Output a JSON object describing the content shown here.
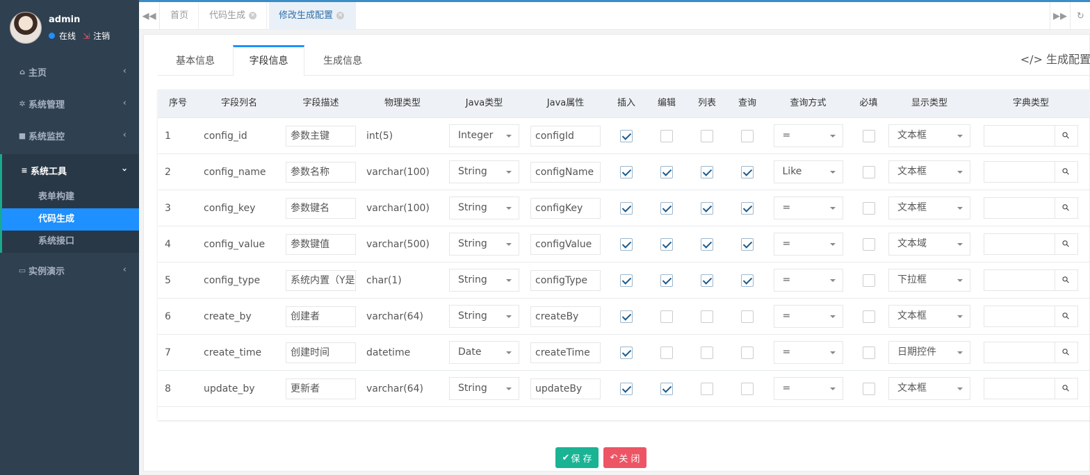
{
  "user": {
    "name": "admin",
    "status": "在线",
    "logout": "注销"
  },
  "nav": [
    {
      "label": "主页",
      "icon": "home-icon"
    },
    {
      "label": "系统管理",
      "icon": "gear-icon"
    },
    {
      "label": "系统监控",
      "icon": "video-icon"
    },
    {
      "label": "系统工具",
      "icon": "bars-icon"
    },
    {
      "label": "实例演示",
      "icon": "desktop-icon"
    }
  ],
  "subnav": [
    "表单构建",
    "代码生成",
    "系统接口"
  ],
  "tabs": [
    "首页",
    "代码生成",
    "修改生成配置"
  ],
  "form_tabs": [
    "基本信息",
    "字段信息",
    "生成信息"
  ],
  "gen_config_link": "生成配置",
  "columns": [
    "序号",
    "字段列名",
    "字段描述",
    "物理类型",
    "Java类型",
    "Java属性",
    "插入",
    "编辑",
    "列表",
    "查询",
    "查询方式",
    "必填",
    "显示类型",
    "字典类型"
  ],
  "rows": [
    {
      "idx": "1",
      "col": "config_id",
      "desc": "参数主键",
      "ptype": "int(5)",
      "jtype": "Integer",
      "jattr": "configId",
      "ins": true,
      "edit": false,
      "list": false,
      "query": false,
      "qtype": "=",
      "req": false,
      "disp": "文本框"
    },
    {
      "idx": "2",
      "col": "config_name",
      "desc": "参数名称",
      "ptype": "varchar(100)",
      "jtype": "String",
      "jattr": "configName",
      "ins": true,
      "edit": true,
      "list": true,
      "query": true,
      "qtype": "Like",
      "req": false,
      "disp": "文本框"
    },
    {
      "idx": "3",
      "col": "config_key",
      "desc": "参数键名",
      "ptype": "varchar(100)",
      "jtype": "String",
      "jattr": "configKey",
      "ins": true,
      "edit": true,
      "list": true,
      "query": true,
      "qtype": "=",
      "req": false,
      "disp": "文本框"
    },
    {
      "idx": "4",
      "col": "config_value",
      "desc": "参数键值",
      "ptype": "varchar(500)",
      "jtype": "String",
      "jattr": "configValue",
      "ins": true,
      "edit": true,
      "list": true,
      "query": true,
      "qtype": "=",
      "req": false,
      "disp": "文本域"
    },
    {
      "idx": "5",
      "col": "config_type",
      "desc": "系统内置（Y是",
      "ptype": "char(1)",
      "jtype": "String",
      "jattr": "configType",
      "ins": true,
      "edit": true,
      "list": true,
      "query": true,
      "qtype": "=",
      "req": false,
      "disp": "下拉框"
    },
    {
      "idx": "6",
      "col": "create_by",
      "desc": "创建者",
      "ptype": "varchar(64)",
      "jtype": "String",
      "jattr": "createBy",
      "ins": true,
      "edit": false,
      "list": false,
      "query": false,
      "qtype": "=",
      "req": false,
      "disp": "文本框"
    },
    {
      "idx": "7",
      "col": "create_time",
      "desc": "创建时间",
      "ptype": "datetime",
      "jtype": "Date",
      "jattr": "createTime",
      "ins": true,
      "edit": false,
      "list": false,
      "query": false,
      "qtype": "=",
      "req": false,
      "disp": "日期控件"
    },
    {
      "idx": "8",
      "col": "update_by",
      "desc": "更新者",
      "ptype": "varchar(64)",
      "jtype": "String",
      "jattr": "updateBy",
      "ins": true,
      "edit": true,
      "list": false,
      "query": false,
      "qtype": "=",
      "req": false,
      "disp": "文本框"
    }
  ],
  "buttons": {
    "save": "保 存",
    "close": "关 闭"
  }
}
